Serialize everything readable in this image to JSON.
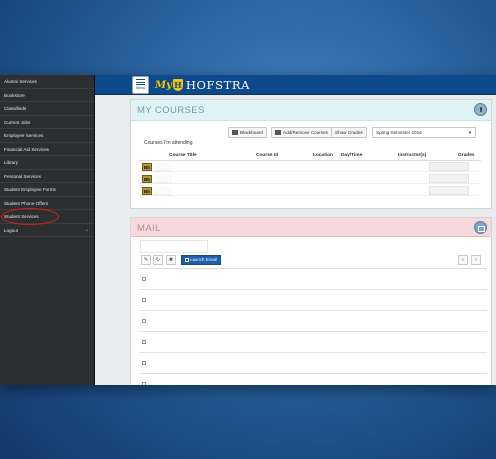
{
  "sidebar": {
    "items": [
      {
        "label": "Alumni Services"
      },
      {
        "label": "Bookstore"
      },
      {
        "label": "Classifieds"
      },
      {
        "label": "Current Jobs"
      },
      {
        "label": "Employee Services"
      },
      {
        "label": "Financial Aid Services"
      },
      {
        "label": "Library"
      },
      {
        "label": "Personal Services"
      },
      {
        "label": "Student Employee Forms"
      },
      {
        "label": "Student Phone Offers"
      },
      {
        "label": "Student Services"
      }
    ],
    "logout_label": "Logout",
    "highlight_color": "#d42020"
  },
  "topbar": {
    "menu_label": "Menu",
    "logo_my": "My",
    "logo_shield": "H",
    "logo_name": "HOFSTRA",
    "brand_color": "#0c4a8c",
    "logo_color": "#f3c400"
  },
  "courses": {
    "title": "MY COURSES",
    "buttons": {
      "blackboard": "Blackboard",
      "add_remove": "Add/Remove Courses",
      "show_grades": "Show Grades"
    },
    "semester": "Spring Semester 2016",
    "section_label": "Courses I'm attending",
    "columns": [
      "Course Title",
      "Course Id",
      "Location",
      "Day/Time",
      "Instructor(s)",
      "Grades"
    ],
    "row_badge": "Bb",
    "rows": [
      {},
      {},
      {}
    ]
  },
  "mail": {
    "title": "MAIL",
    "launch_label": "Launch Email",
    "toolbar_icons": [
      "edit-icon",
      "refresh-icon",
      "trash-icon"
    ],
    "rows": [
      {},
      {},
      {},
      {},
      {},
      {}
    ]
  }
}
